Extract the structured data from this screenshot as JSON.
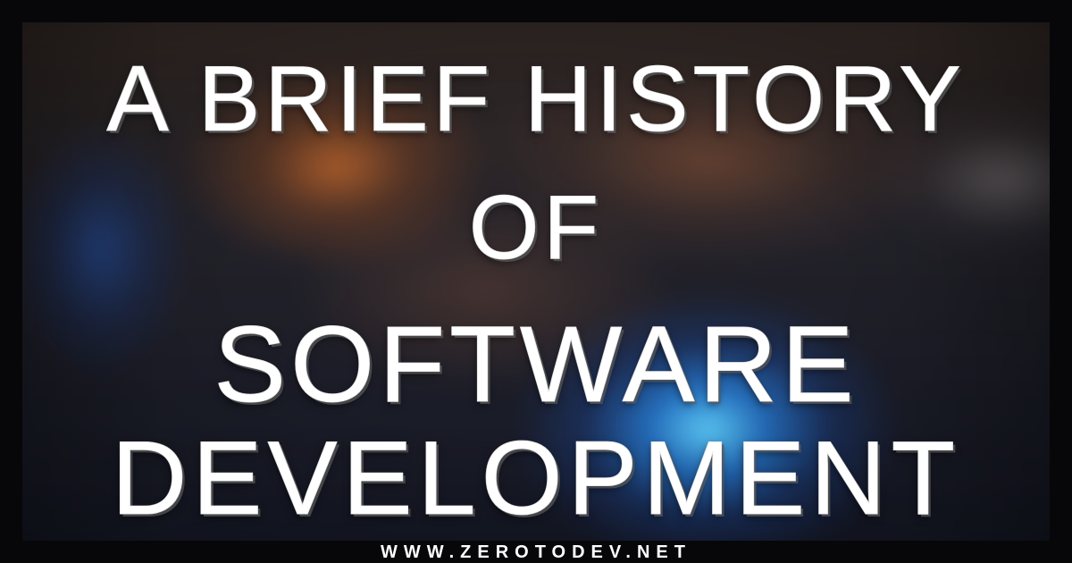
{
  "graphic": {
    "headline_lines": [
      "A BRIEF HISTORY",
      "OF",
      "SOFTWARE",
      "DEVELOPMENT"
    ],
    "website": "WWW.ZEROTODEV.NET"
  },
  "colors": {
    "outer_frame": "#070709",
    "headline_text": "#ffffff",
    "orange_bokeh": "#cc6b2b",
    "blue_bokeh": "#5fd2ff",
    "dark_background": "#141722"
  }
}
